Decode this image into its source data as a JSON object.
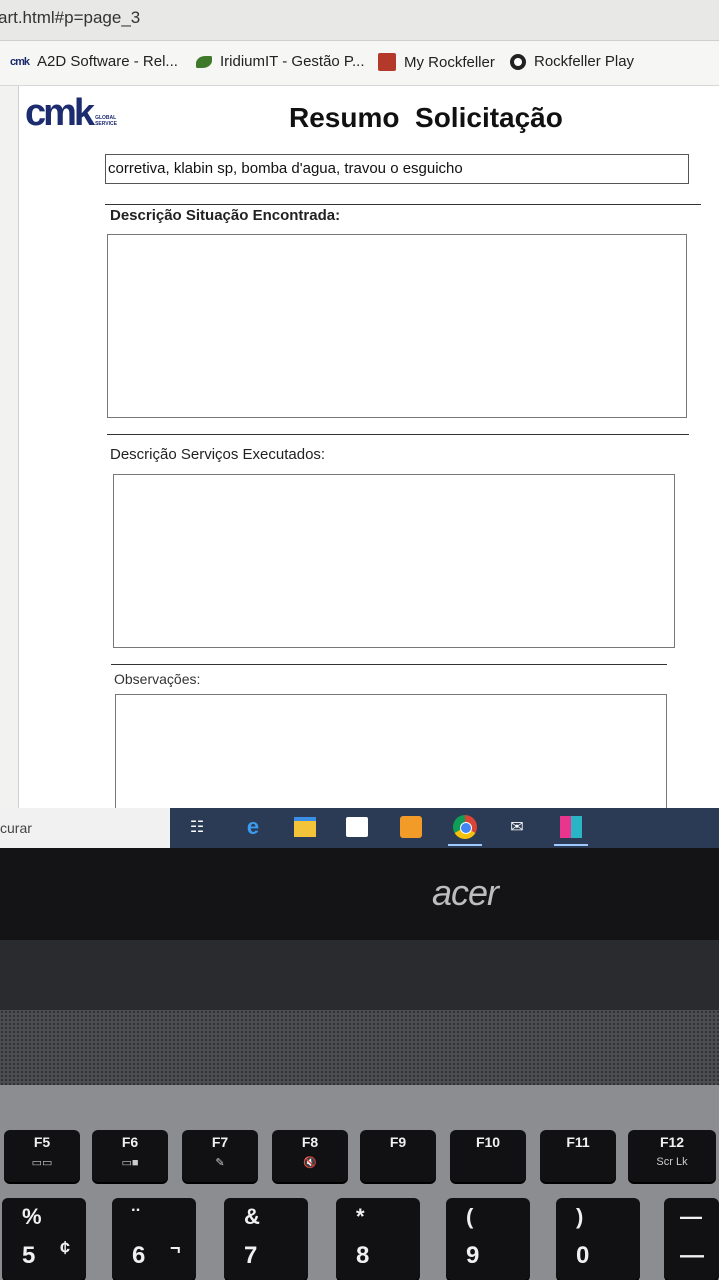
{
  "browser": {
    "url": "art.html#p=page_3",
    "bookmarks": [
      {
        "label": "A2D Software - Rel...",
        "icon": "cmk-icon"
      },
      {
        "label": "IridiumIT - Gestão P...",
        "icon": "leaf-icon"
      },
      {
        "label": "My Rockfeller",
        "icon": "rockfeller-icon"
      },
      {
        "label": "Rockfeller Play",
        "icon": "play-icon"
      }
    ]
  },
  "report": {
    "logo_text": "cmk",
    "logo_sub": "GLOBAL SERVICE",
    "title": "Resumo  Solicitação",
    "subject": "corretiva, klabin sp, bomba d'agua, travou o esguicho",
    "section_found": "Descrição Situação Encontrada:",
    "section_services": "Descrição Serviços Executados:",
    "section_notes": "Observações:"
  },
  "taskbar": {
    "search_text": "curar",
    "icons": [
      "task-view-icon",
      "edge-icon",
      "file-explorer-icon",
      "store-icon",
      "sublime-icon",
      "chrome-icon",
      "mail-icon",
      "app-icon"
    ]
  },
  "laptop": {
    "brand": "acer",
    "function_keys": [
      {
        "label": "F5",
        "sub": "▭▭"
      },
      {
        "label": "F6",
        "sub": "▭■"
      },
      {
        "label": "F7",
        "sub": "✎"
      },
      {
        "label": "F8",
        "sub": "🔇"
      },
      {
        "label": "F9",
        "sub": ""
      },
      {
        "label": "F10",
        "sub": ""
      },
      {
        "label": "F11",
        "sub": ""
      },
      {
        "label": "F12",
        "sub": "Scr Lk"
      }
    ],
    "number_keys": [
      {
        "top": "%",
        "bottom": "5",
        "alt": "¢"
      },
      {
        "top": "¨",
        "bottom": "6",
        "alt": "¬"
      },
      {
        "top": "&",
        "bottom": "7",
        "alt": ""
      },
      {
        "top": "*",
        "bottom": "8",
        "alt": ""
      },
      {
        "top": "(",
        "bottom": "9",
        "alt": ""
      },
      {
        "top": ")",
        "bottom": "0",
        "alt": ""
      },
      {
        "top": "—",
        "bottom": "—",
        "alt": ""
      }
    ]
  }
}
